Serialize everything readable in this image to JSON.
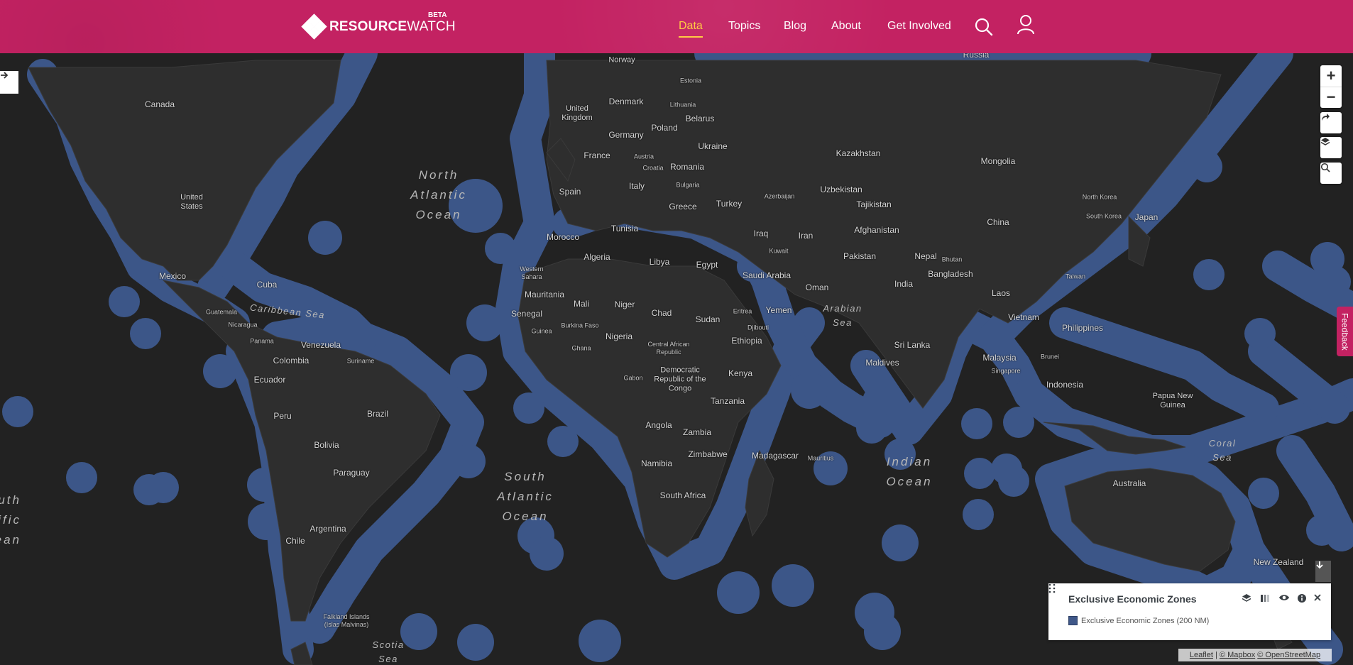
{
  "header": {
    "logo_bold": "RESOURCE",
    "logo_light": "WATCH",
    "beta": "BETA",
    "nav": [
      {
        "label": "Data",
        "active": true
      },
      {
        "label": "Topics",
        "active": false
      },
      {
        "label": "Blog",
        "active": false
      },
      {
        "label": "About",
        "active": false
      },
      {
        "label": "Get Involved",
        "active": false
      }
    ],
    "icons": [
      "search-icon",
      "user-icon"
    ]
  },
  "map": {
    "zone_color": "#3c5688",
    "land_color": "#2e2e2e",
    "countries": [
      "Russia",
      "Norway",
      "Estonia",
      "Canada",
      "United Kingdom",
      "Denmark",
      "Lithuania",
      "Belarus",
      "Germany",
      "Poland",
      "Ukraine",
      "France",
      "Austria",
      "Croatia",
      "Romania",
      "Kazakhstan",
      "Mongolia",
      "Italy",
      "Bulgaria",
      "Spain",
      "Greece",
      "Turkey",
      "Azerbaijan",
      "Uzbekistan",
      "Tajikistan",
      "United States",
      "North Korea",
      "South Korea",
      "Japan",
      "China",
      "Tunisia",
      "Morocco",
      "Iraq",
      "Iran",
      "Afghanistan",
      "Algeria",
      "Libya",
      "Egypt",
      "Kuwait",
      "Pakistan",
      "Nepal",
      "Bhutan",
      "Western Sahara",
      "Saudi Arabia",
      "Bangladesh",
      "Mexico",
      "Cuba",
      "Oman",
      "India",
      "Mauritania",
      "Mali",
      "Niger",
      "Chad",
      "Sudan",
      "Eritrea",
      "Yemen",
      "Laos",
      "Taiwan",
      "Guatemala",
      "Senegal",
      "Vietnam",
      "Nicaragua",
      "Guinea",
      "Burkina Faso",
      "Djibouti",
      "Philippines",
      "Panama",
      "Venezuela",
      "Nigeria",
      "Central African Republic",
      "Ethiopia",
      "Ghana",
      "Colombia",
      "Suriname",
      "Sri Lanka",
      "Malaysia",
      "Brunei",
      "Maldives",
      "Singapore",
      "Ecuador",
      "Democratic Republic of the Congo",
      "Gabon",
      "Kenya",
      "Indonesia",
      "Papua New Guinea",
      "Peru",
      "Brazil",
      "Tanzania",
      "Bolivia",
      "Angola",
      "Zambia",
      "Zimbabwe",
      "Madagascar",
      "Mauritius",
      "Namibia",
      "Paraguay",
      "Australia",
      "South Africa",
      "Argentina",
      "Chile",
      "New Zealand",
      "Falkland Islands (Islas Malvinas)"
    ],
    "oceans": [
      "North Atlantic Ocean",
      "South Atlantic Ocean",
      "Indian Ocean",
      "Caribbean Sea",
      "Arabian Sea",
      "Coral Sea",
      "Scotia Sea",
      "South Pacific Ocean"
    ]
  },
  "controls": {
    "zoom_in": "+",
    "zoom_out": "−",
    "feedback": "Feedback"
  },
  "legend": {
    "title": "Exclusive Economic Zones",
    "item": "Exclusive Economic Zones (200 NM)",
    "swatch_color": "#3f5788"
  },
  "attribution": {
    "leaflet": "Leaflet",
    "sep": " | ",
    "mapbox": "© Mapbox",
    "osm": "© OpenStreetMap"
  }
}
